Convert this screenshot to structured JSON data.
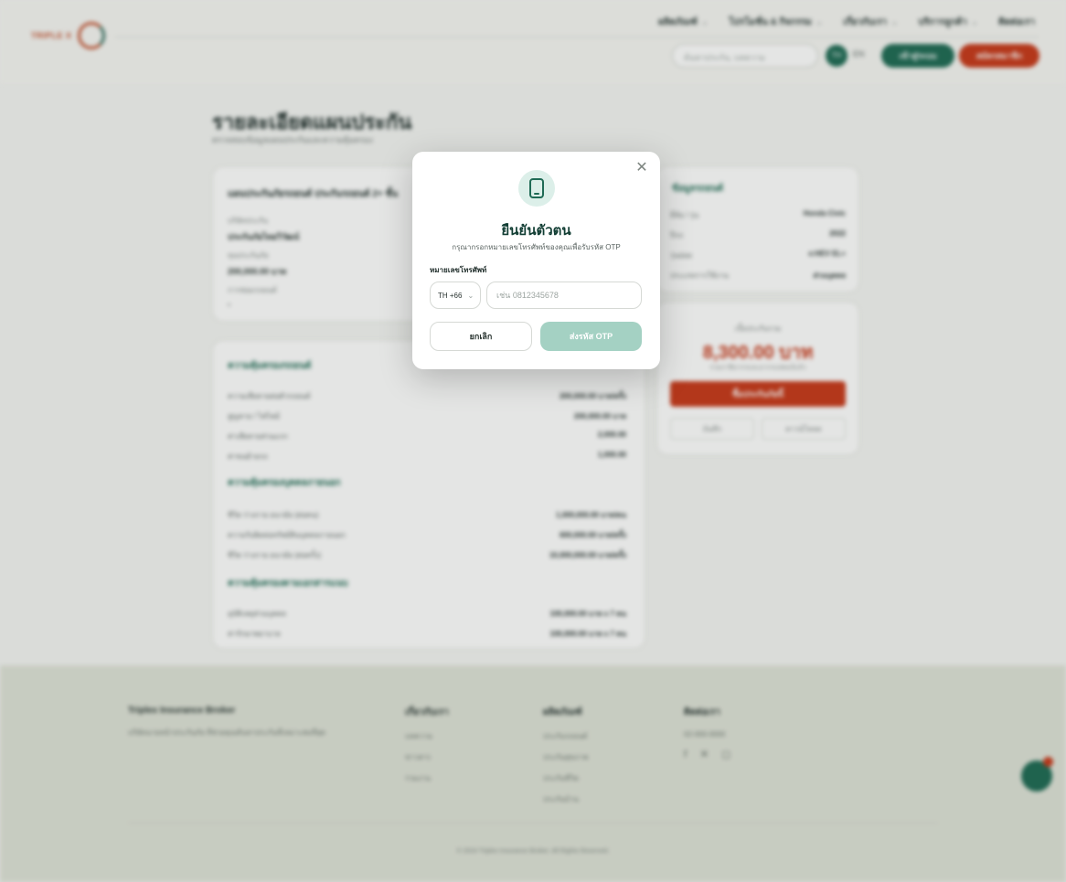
{
  "header": {
    "logo_text": "TRIPLE X",
    "nav": [
      "ผลิตภัณฑ์",
      "โปรโมชั่น & กิจกรรม",
      "เกี่ยวกับเรา",
      "บริการลูกค้า",
      "ติดต่อเรา"
    ],
    "search_placeholder": "ค้นหาประกัน, บทความ",
    "user_initials": "TH",
    "lang": "EN",
    "login_label": "เข้าสู่ระบบ",
    "signup_label": "สมัครสมาชิก"
  },
  "page": {
    "title": "รายละเอียดแผนประกัน",
    "subtitle": "ตรวจสอบข้อมูลแผนประกันและความคุ้มครอง"
  },
  "plan_card": {
    "title": "แผนประกันภัยรถยนต์ ประกันรถยนต์ 2+ ชั้น",
    "fields": [
      {
        "label": "บริษัทประกัน",
        "value": "ประกันภัยไทยวิวัฒน์"
      },
      {
        "label": "ทุนประกันภัย",
        "value": "200,000.00 บาท"
      },
      {
        "label": "การซ่อมรถยนต์",
        "value": "-"
      }
    ]
  },
  "coverage": {
    "sections": [
      {
        "title": "ความคุ้มครองรถยนต์",
        "rows": [
          {
            "label": "ความเสียหายต่อตัวรถยนต์",
            "value": "200,000.00 บาท/ครั้ง"
          },
          {
            "label": "สูญหาย / ไฟไหม้",
            "value": "200,000.00 บาท"
          },
          {
            "label": "ค่าเสียหายส่วนแรก",
            "value": "2,000.00"
          },
          {
            "label": "ค่าขนย้ายรถ",
            "value": "1,000.00"
          }
        ]
      },
      {
        "title": "ความคุ้มครองบุคคลภายนอก",
        "rows": [
          {
            "label": "ชีวิต ร่างกาย อนามัย (ต่อคน)",
            "value": "1,000,000.00 บาท/คน"
          },
          {
            "label": "ความรับผิดต่อทรัพย์สินบุคคลภายนอก",
            "value": "600,000.00 บาท/ครั้ง"
          },
          {
            "label": "ชีวิต ร่างกาย อนามัย (ต่อครั้ง)",
            "value": "10,000,000.00 บาท/ครั้ง"
          }
        ]
      },
      {
        "title": "ความคุ้มครองตามเอกสารแนบ",
        "rows": [
          {
            "label": "อุบัติเหตุส่วนบุคคล",
            "value": "100,000.00 บาท x 7 คน"
          },
          {
            "label": "ค่ารักษาพยาบาล",
            "value": "100,000.00 บาท x 7 คน"
          }
        ]
      }
    ]
  },
  "car_info": {
    "title": "ข้อมูลรถยนต์",
    "rows": [
      {
        "label": "ยี่ห้อ / รุ่น",
        "value": "Honda Civic"
      },
      {
        "label": "ปีรถ",
        "value": "2022"
      },
      {
        "label": "รุ่นย่อย",
        "value": "e:HEV EL+"
      },
      {
        "label": "ประเภทการใช้งาน",
        "value": "ส่วนบุคคล"
      }
    ]
  },
  "price_card": {
    "label": "เบี้ยประกันรวม",
    "price": "8,300.00 บาท",
    "note": "รวมภาษีอากรและอากรแสตมป์แล้ว",
    "buy_label": "ซื้อประกันภัยนี้",
    "save_label": "บันทึก",
    "download_label": "ดาวน์โหลด"
  },
  "footer": {
    "company": "Triplex Insurance Broker",
    "company_desc": "บริษัทนายหน้าประกันภัย ที่ช่วยคุณค้นหาประกันที่เหมาะสมที่สุด",
    "col2": {
      "title": "เกี่ยวกับเรา",
      "items": [
        "บทความ",
        "ข่าวสาร",
        "ร่วมงาน"
      ]
    },
    "col3": {
      "title": "ผลิตภัณฑ์",
      "items": [
        "ประกันรถยนต์",
        "ประกันสุขภาพ",
        "ประกันชีวิต",
        "ประกันบ้าน"
      ]
    },
    "col4": {
      "title": "ติดต่อเรา",
      "items": [
        "02-000-0000"
      ]
    },
    "copyright": "© 2024 Triplex Insurance Broker. All Rights Reserved."
  },
  "modal": {
    "title": "ยืนยันตัวตน",
    "subtitle": "กรุณากรอกหมายเลขโทรศัพท์ของคุณเพื่อรับรหัส OTP",
    "phone_label": "หมายเลขโทรศัพท์",
    "country_code": "TH +66",
    "phone_placeholder": "เช่น 0812345678",
    "cancel_label": "ยกเลิก",
    "submit_label": "ส่งรหัส OTP"
  },
  "colors": {
    "primary_green": "#1f6b55",
    "accent_red": "#c83a1b",
    "otp_button_disabled": "#a4d1c3"
  }
}
